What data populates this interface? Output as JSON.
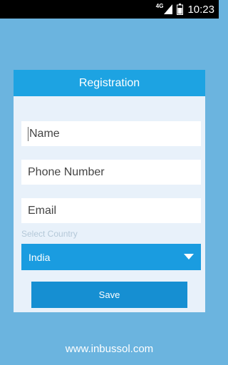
{
  "status_bar": {
    "network": "4G",
    "time": "10:23"
  },
  "card": {
    "title": "Registration",
    "fields": {
      "name_placeholder": "Name",
      "phone_placeholder": "Phone Number",
      "email_placeholder": "Email"
    },
    "country": {
      "label": "Select Country",
      "selected": "India"
    },
    "save_label": "Save"
  },
  "footer": {
    "url": "www.inbussol.com"
  },
  "colors": {
    "background": "#6bb4df",
    "header": "#1da3e2",
    "select": "#1a9ce0",
    "button": "#168fd2"
  }
}
